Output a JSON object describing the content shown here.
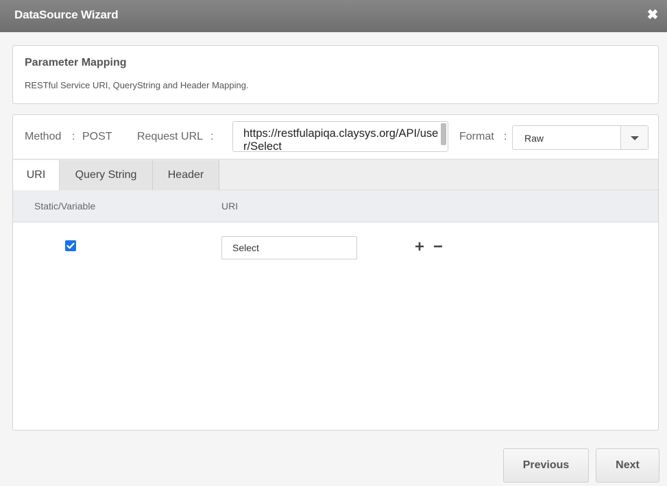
{
  "window": {
    "title": "DataSource Wizard",
    "close_icon": "close-icon"
  },
  "header": {
    "title": "Parameter Mapping",
    "subtitle": "RESTful Service URI, QueryString and Header Mapping."
  },
  "request": {
    "method_label": "Method",
    "separator": ":",
    "method_value": "POST",
    "url_label": "Request URL",
    "url_value": "https://restfulapiqa.claysys.org/API/user/Select",
    "format_label": "Format",
    "format_value": "Raw"
  },
  "tabs": [
    {
      "label": "URI",
      "active": true
    },
    {
      "label": "Query String",
      "active": false
    },
    {
      "label": "Header",
      "active": false
    }
  ],
  "grid": {
    "columns": [
      "Static/Variable",
      "URI"
    ],
    "rows": [
      {
        "static_checked": true,
        "uri_value": "Select"
      }
    ]
  },
  "footer": {
    "previous_label": "Previous",
    "next_label": "Next"
  },
  "colors": {
    "titlebar": "#7a7a7a",
    "checkbox": "#1a73e8"
  }
}
